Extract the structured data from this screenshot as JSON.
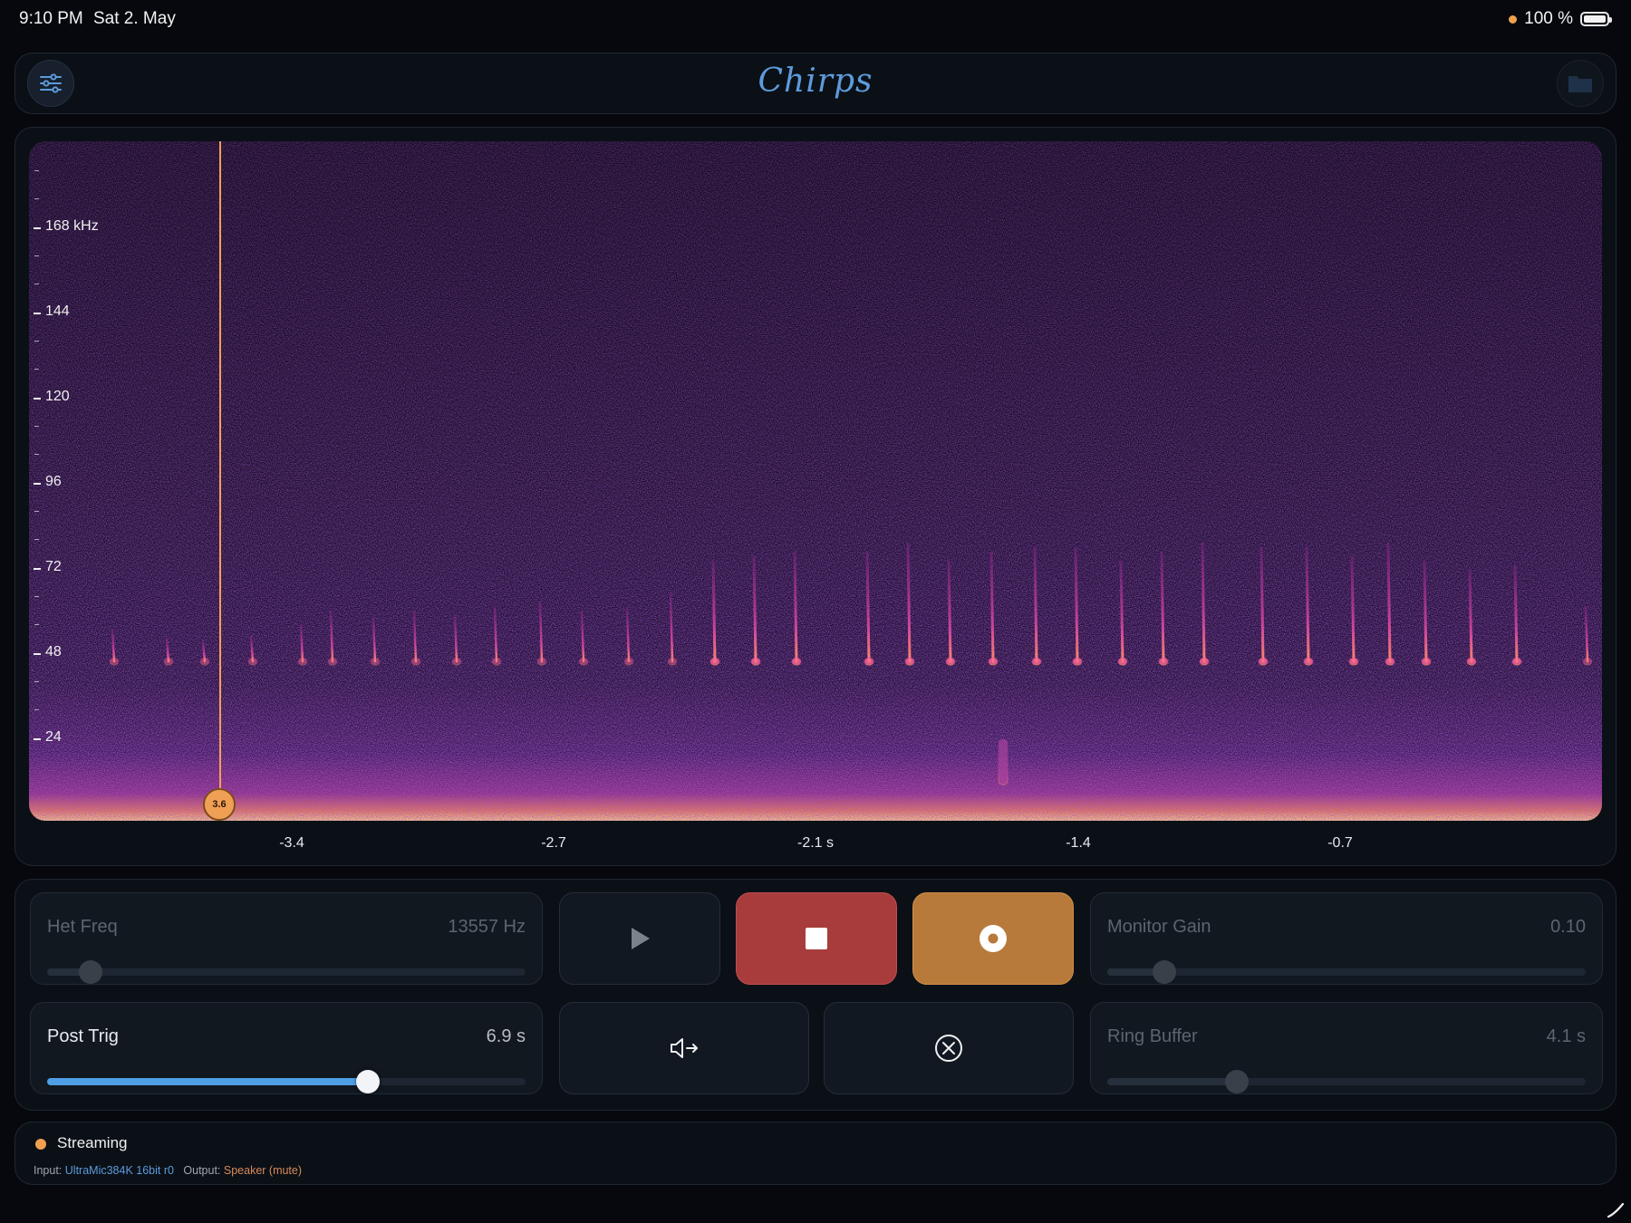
{
  "status_bar": {
    "time": "9:10 PM",
    "date": "Sat 2. May",
    "battery": "100 %"
  },
  "header": {
    "title": "Chirps",
    "left_icon": "sliders-icon",
    "right_icon": "folder-icon"
  },
  "spectrogram": {
    "y_labels": [
      "168 kHz",
      "144",
      "120",
      "96",
      "72",
      "48",
      "24"
    ],
    "x_labels": [
      "-3.4",
      "-2.7",
      "-2.1 s",
      "-1.4",
      "-0.7"
    ],
    "cursor_value": "3.6"
  },
  "controls": {
    "het_freq": {
      "label": "Het Freq",
      "value": "13557 Hz",
      "level": 0.09
    },
    "monitor_gain": {
      "label": "Monitor Gain",
      "value": "0.10",
      "level": 0.12
    },
    "post_trig": {
      "label": "Post Trig",
      "value": "6.9 s",
      "level": 0.67
    },
    "ring_buffer": {
      "label": "Ring Buffer",
      "value": "4.1 s",
      "level": 0.27
    },
    "buttons": [
      "play-icon",
      "stop-icon",
      "record-icon",
      "speaker-output-icon",
      "clear-icon"
    ],
    "colors": {
      "stop": "#a83c3c",
      "record": "#b87a3a",
      "accent": "#4f9fe6"
    }
  },
  "footer": {
    "status": "Streaming",
    "input_label": "Input:",
    "input_value": "UltraMic384K 16bit r0",
    "output_label": "Output:",
    "output_value": "Speaker (mute)"
  }
}
